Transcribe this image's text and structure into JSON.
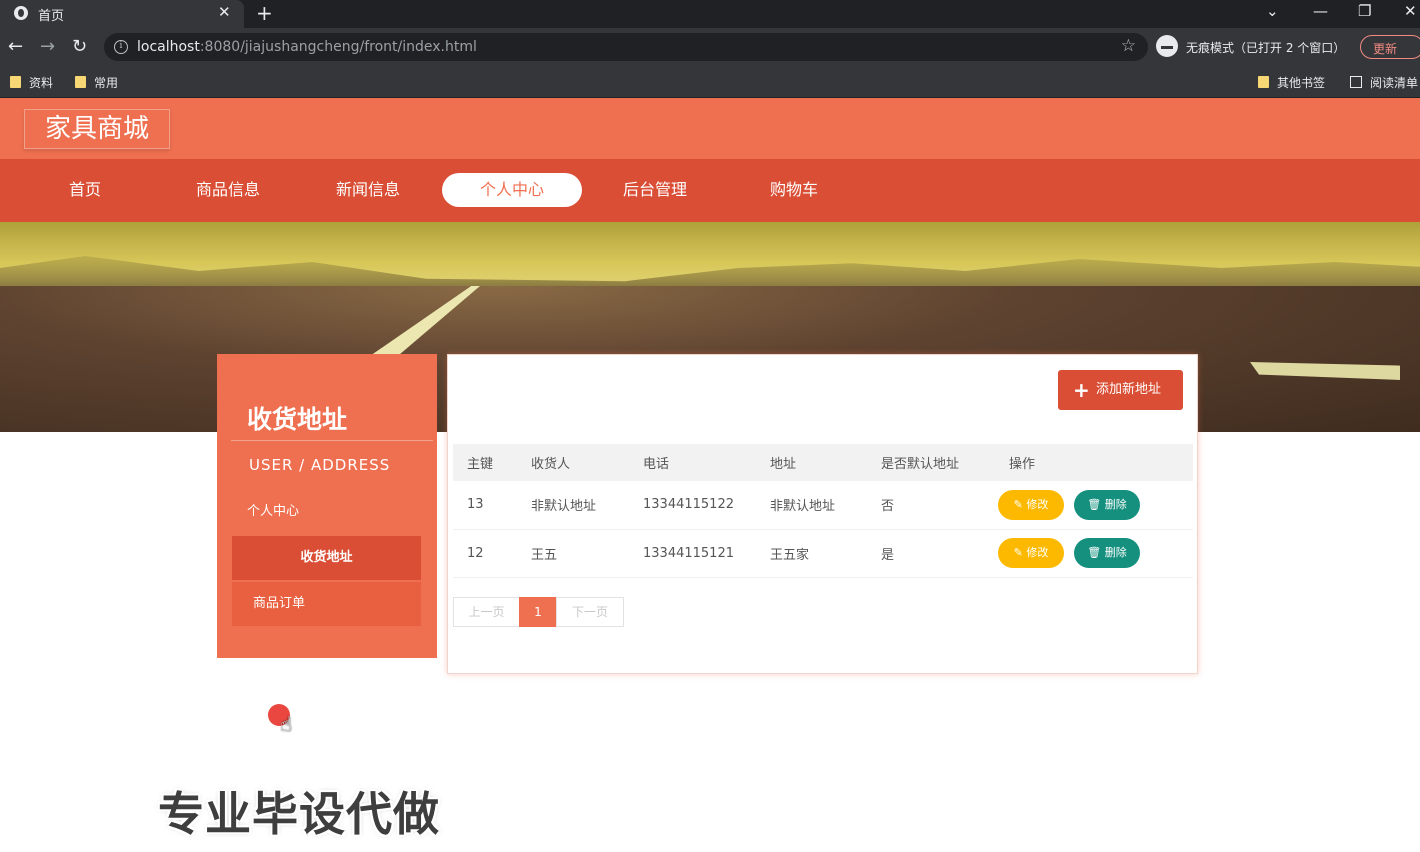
{
  "browser": {
    "tab_title": "首页",
    "new_tab": "+",
    "url_host": "localhost",
    "url_rest": ":8080/jiajushangcheng/front/index.html",
    "incognito_text": "无痕模式（已打开 2 个窗口）",
    "update_label": "更新",
    "bookmarks": [
      "资料",
      "常用"
    ],
    "bookmarks_right": [
      "其他书签",
      "阅读清单"
    ]
  },
  "site": {
    "logo": "家具商城",
    "nav": [
      "首页",
      "商品信息",
      "新闻信息",
      "个人中心",
      "后台管理",
      "购物车"
    ],
    "active_nav_index": 3
  },
  "banner": {
    "slides": 3,
    "active_slide": 0
  },
  "sidebar": {
    "title": "收货地址",
    "subtitle": "USER / ADDRESS",
    "items": [
      "个人中心",
      "收货地址",
      "商品订单"
    ],
    "active_index": 1
  },
  "content": {
    "add_button": "添加新地址",
    "columns": [
      "主键",
      "收货人",
      "电话",
      "地址",
      "是否默认地址",
      "操作"
    ],
    "rows": [
      {
        "id": "13",
        "name": "非默认地址",
        "phone": "13344115122",
        "address": "非默认地址",
        "is_default": "否"
      },
      {
        "id": "12",
        "name": "王五",
        "phone": "13344115121",
        "address": "王五家",
        "is_default": "是"
      }
    ],
    "edit_label": "修改",
    "delete_label": "删除",
    "pager": {
      "prev": "上一页",
      "current": "1",
      "next": "下一页"
    }
  },
  "overlay": {
    "watermark": "专业毕设代做"
  },
  "colors": {
    "primary": "#ef7050",
    "nav_bg": "#d94e34",
    "edit": "#fcb900",
    "delete": "#16907e"
  }
}
